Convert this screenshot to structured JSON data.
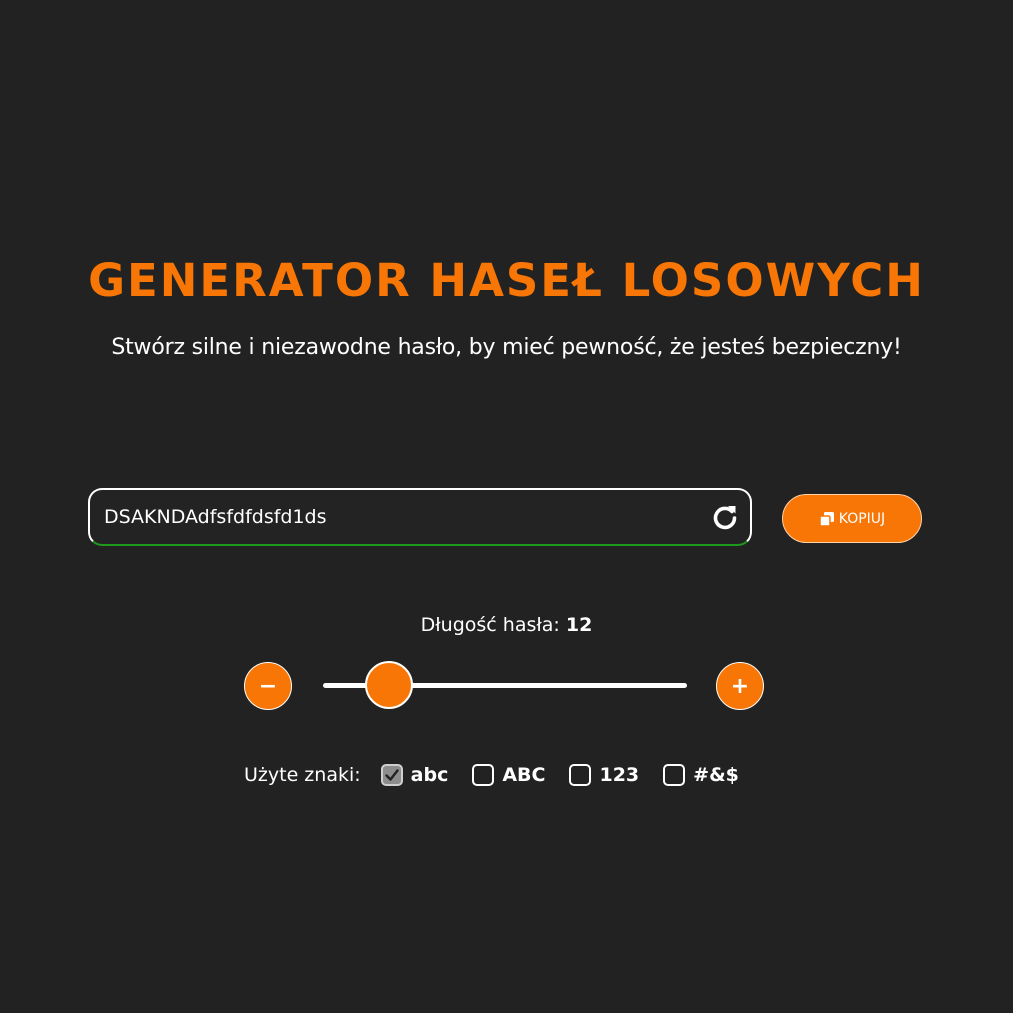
{
  "header": {
    "title": "GENERATOR HASEŁ LOSOWYCH",
    "subtitle": "Stwórz silne i niezawodne hasło, by mieć pewność, że jesteś bezpieczny!"
  },
  "password": {
    "value": "DSAKNDAdfsfdfdsfd1ds",
    "refresh_icon": "refresh-icon"
  },
  "copy_button": {
    "label": "KOPIUJ",
    "icon": "copy-icon"
  },
  "length": {
    "label": "Długość hasła:",
    "value": "12",
    "min_label": "−",
    "plus_label": "+",
    "slider_fraction": 0.18
  },
  "characters": {
    "label": "Użyte znaki:",
    "options": [
      {
        "label": "abc",
        "checked": true
      },
      {
        "label": "ABC",
        "checked": false
      },
      {
        "label": "123",
        "checked": false
      },
      {
        "label": "#&$",
        "checked": false
      }
    ]
  },
  "colors": {
    "accent": "#f77605",
    "background": "#222222",
    "strength_indicator": "#1e9a1e"
  }
}
